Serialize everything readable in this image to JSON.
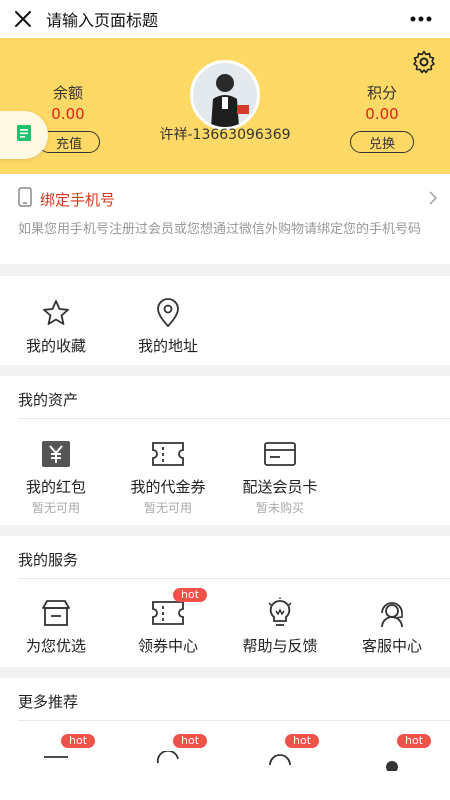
{
  "nav": {
    "title": "请输入页面标题"
  },
  "profile": {
    "balance_label": "余额",
    "balance_value": "0.00",
    "recharge_label": "充值",
    "points_label": "积分",
    "points_value": "0.00",
    "exchange_label": "兑换",
    "user_name": "许祥-13663096369"
  },
  "bind_phone": {
    "title": "绑定手机号",
    "description": "如果您用手机号注册过会员或您想通过微信外购物请绑定您的手机号码"
  },
  "quick_links": [
    {
      "label": "我的收藏",
      "icon": "star-icon"
    },
    {
      "label": "我的地址",
      "icon": "location-pin-icon"
    }
  ],
  "assets": {
    "title": "我的资产",
    "items": [
      {
        "label": "我的红包",
        "sub": "暂无可用",
        "icon": "yen-icon"
      },
      {
        "label": "我的代金券",
        "sub": "暂无可用",
        "icon": "ticket-icon"
      },
      {
        "label": "配送会员卡",
        "sub": "暂未购买",
        "icon": "card-icon"
      }
    ]
  },
  "services": {
    "title": "我的服务",
    "items": [
      {
        "label": "为您优选",
        "icon": "store-icon",
        "badge": ""
      },
      {
        "label": "领券中心",
        "icon": "coupon-icon",
        "badge": "hot"
      },
      {
        "label": "帮助与反馈",
        "icon": "lightbulb-icon",
        "badge": ""
      },
      {
        "label": "客服中心",
        "icon": "headset-icon",
        "badge": ""
      }
    ]
  },
  "recommend": {
    "title": "更多推荐",
    "badges": [
      "hot",
      "hot",
      "hot",
      "hot"
    ]
  },
  "colors": {
    "header_bg": "#ffd966",
    "price_red": "#e02020",
    "accent_red": "#d4361c",
    "hot_badge": "#f0524a"
  }
}
